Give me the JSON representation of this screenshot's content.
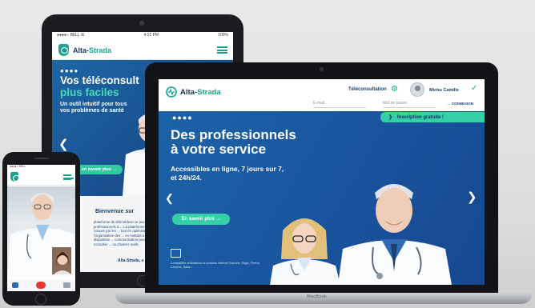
{
  "brand": {
    "name_a": "Alta-",
    "name_b": "Strada",
    "accent": "#16a38c",
    "primary": "#1a3f6e"
  },
  "tablet": {
    "status": {
      "carrier": "●●●●○ BELL ☰",
      "time": "4:21 PM",
      "battery": "100%"
    },
    "hero": {
      "dots": "●●●●",
      "title_line1": "Vos téléconsult",
      "title_line2": "plus faciles",
      "subtitle": "Un outil intuitif pour tous vos problèmes de santé",
      "cta": "en savoir plus →"
    },
    "lower": {
      "title": "Bienvenue sur",
      "text": "plateforme de télémédecin et aux professionnels d ... La plateforme a été conçue par les ... tout en optimisant l'organisation des ... en mettant à leur disposition ... communication pour consulter ... ou d'autres outils.",
      "signature": "Alta-Strada, u"
    }
  },
  "laptop": {
    "header": {
      "teleconsultation": "Téléconsultation",
      "user_name": "Michu Camille"
    },
    "login": {
      "email_placeholder": "E-mail",
      "password_placeholder": "Mot de passe",
      "connect": "→ CONNEXION"
    },
    "banner": "Inscription gratuite !",
    "hero": {
      "dots": "●●●●",
      "title_line1": "Des professionnels",
      "title_line2": "à votre service",
      "subtitle": "Accessibles en ligne, 7 jours sur 7, et 24h/24.",
      "cta": "En savoir plus →",
      "compat": "Compatible ordinateurs et mobiles Internet Explorer, Edge, Firefox, Chrome, Safari"
    },
    "model": "MacBook"
  },
  "phone": {
    "status": "●●●●○ BELL",
    "icons": [
      "chat-icon",
      "hangup-icon",
      "video-icon"
    ]
  }
}
